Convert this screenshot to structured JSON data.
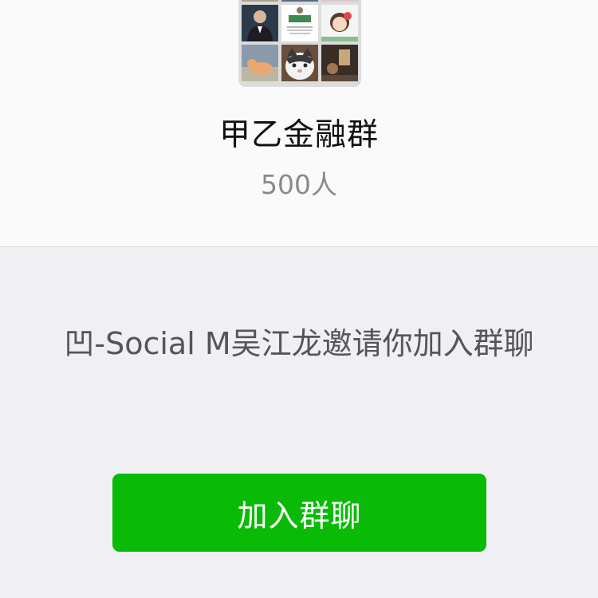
{
  "group": {
    "name": "甲乙金融群",
    "member_count": "500人",
    "avatar_tiles": [
      "member-photo-1",
      "member-photo-2",
      "member-photo-3",
      "man-in-suit-photo",
      "promo-card-image",
      "cartoon-girl-image",
      "cat-photo-1",
      "cat-photo-2",
      "room-photo"
    ],
    "promo_card_text": "播种未来"
  },
  "invitation": {
    "text": "凹-Social M吴江龙邀请你加入群聊"
  },
  "actions": {
    "join_label": "加入群聊"
  },
  "colors": {
    "join_button": "#09bb07",
    "top_background": "#fafafa",
    "page_background": "#efeff4"
  }
}
